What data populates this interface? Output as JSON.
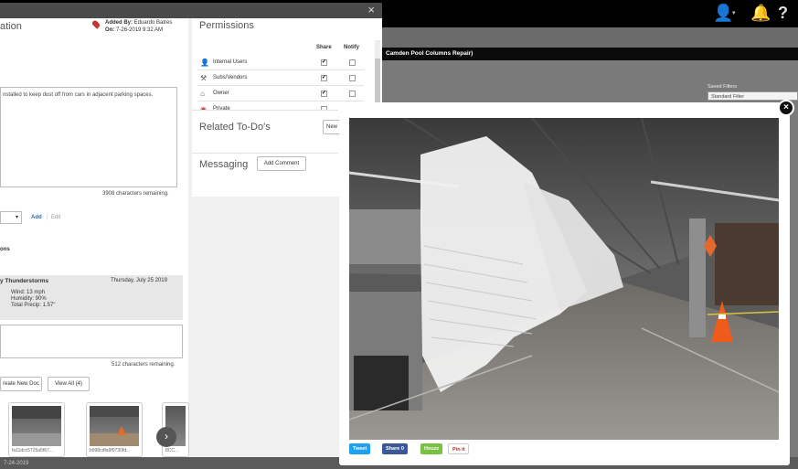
{
  "topbar": {
    "user_icon": "user-icon",
    "bell_icon": "bell-icon",
    "help_label": "?"
  },
  "background_page": {
    "title_bar": "Camden Pool Columns Repair)",
    "saved_filters_label": "Saved Filters",
    "saved_filter_value": "Standard Filter"
  },
  "modal": {
    "section_title_fragment": "ation",
    "added_by_label": "Added By:",
    "added_by_name": "Eduardo Batres",
    "added_on_label": "On:",
    "added_on_value": "7-26-2019 9:32 AM",
    "description": "nstalled to keep dust off from cars in adjacent parking spaces.",
    "description_remaining": "3908 characters remaining.",
    "add_link": "Add",
    "edit_link": "Edit",
    "conditions_fragment": "ons",
    "weather": {
      "condition": "y Thunderstorms",
      "date": "Thursday, July 25 2019",
      "wind": "Wind:  13 mph",
      "humidity": "Humidity:  90%",
      "precip": "Total Precip:  1.57\""
    },
    "notes_remaining": "512 characters remaining.",
    "create_doc_button": "reate New Doc",
    "view_all_button": "View All (4)",
    "thumbs": [
      {
        "caption": "fa11dcc5725a5f67..."
      },
      {
        "caption": "b998cdfa9f0730fd..."
      },
      {
        "caption": "8CC..."
      }
    ],
    "close_label": "×"
  },
  "permissions": {
    "title": "Permissions",
    "share_header": "Share",
    "notify_header": "Notify",
    "rows": [
      {
        "label": "Internal Users",
        "share": "✔",
        "notify": ""
      },
      {
        "label": "Subs/Vendors",
        "share": "✔",
        "notify": ""
      },
      {
        "label": "Owner",
        "share": "✔",
        "notify": ""
      },
      {
        "label": "Private",
        "share": "",
        "notify": ""
      }
    ],
    "related_todos_title": "Related To-Do's",
    "new_button": "New",
    "messaging_title": "Messaging",
    "add_comment_button": "Add Comment"
  },
  "lightbox": {
    "close_label": "×",
    "tweet": "Tweet",
    "share": "Share 0",
    "houzz": "Houzz",
    "pinit": "Pin it"
  },
  "bottom": {
    "text": "7-24-2019"
  },
  "colors": {
    "tweet": "#1da1f2",
    "facebook": "#3b5998",
    "houzz": "#7ac142",
    "pinterest": "#cb2027"
  }
}
